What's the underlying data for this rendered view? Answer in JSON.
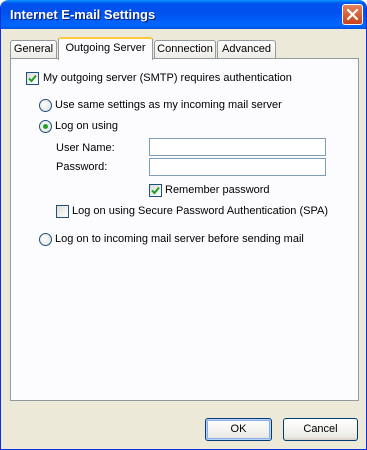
{
  "window": {
    "title": "Internet E-mail Settings",
    "close_icon": "close-icon"
  },
  "tabs": [
    {
      "label": "General",
      "active": false
    },
    {
      "label": "Outgoing Server",
      "active": true
    },
    {
      "label": "Connection",
      "active": false
    },
    {
      "label": "Advanced",
      "active": false
    }
  ],
  "outgoing": {
    "smtp_auth": {
      "label": "My outgoing server (SMTP) requires authentication",
      "checked": true
    },
    "same_settings": {
      "label": "Use same settings as my incoming mail server",
      "selected": false
    },
    "log_on_using": {
      "label": "Log on using",
      "selected": true
    },
    "username": {
      "label": "User Name:",
      "value": ""
    },
    "password": {
      "label": "Password:",
      "value": ""
    },
    "remember": {
      "label": "Remember password",
      "checked": true
    },
    "spa": {
      "label": "Log on using Secure Password Authentication (SPA)",
      "checked": false
    },
    "log_on_incoming": {
      "label": "Log on to incoming mail server before sending mail",
      "selected": false
    }
  },
  "buttons": {
    "ok": "OK",
    "cancel": "Cancel"
  }
}
